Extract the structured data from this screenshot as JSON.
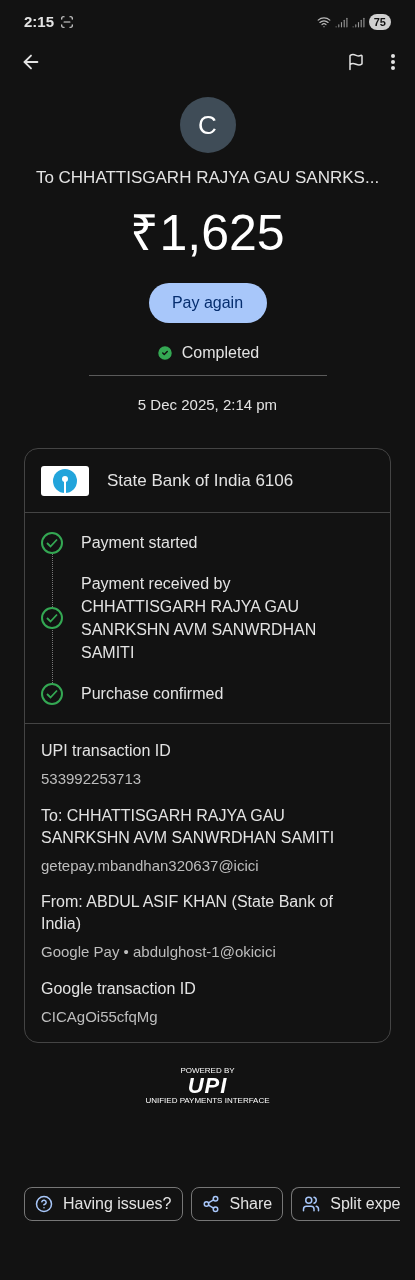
{
  "status_bar": {
    "time": "2:15",
    "battery": "75"
  },
  "payee": {
    "initial": "C",
    "name": "To CHHATTISGARH RAJYA GAU SANRKS..."
  },
  "amount": "₹1,625",
  "pay_again": "Pay again",
  "status": "Completed",
  "date": "5 Dec 2025, 2:14 pm",
  "bank": {
    "name": "State Bank of India 6106"
  },
  "timeline": [
    {
      "label": "Payment started",
      "done": true
    },
    {
      "label": "Payment received by CHHATTISGARH RAJYA GAU SANRKSHN AVM SANWRDHAN SAMITI",
      "done": true
    },
    {
      "label": "Purchase confirmed",
      "done": true
    }
  ],
  "details": [
    {
      "title": "UPI transaction ID",
      "value": "533992253713"
    },
    {
      "title": "To: CHHATTISGARH RAJYA GAU SANRKSHN AVM SANWRDHAN SAMITI",
      "value": "getepay.mbandhan320637@icici"
    },
    {
      "title": "From: ABDUL ASIF KHAN (State Bank of India)",
      "value": "Google Pay • abdulghost-1@okicici"
    },
    {
      "title": "Google transaction ID",
      "value": "CICAgOi55cfqMg"
    }
  ],
  "upi_logo": {
    "top": "POWERED BY",
    "mark": "UPI",
    "bottom": "UNIFIED PAYMENTS INTERFACE"
  },
  "actions": [
    {
      "kind": "help",
      "label": "Having issues?"
    },
    {
      "kind": "share",
      "label": "Share"
    },
    {
      "kind": "split",
      "label": "Split expe"
    }
  ]
}
